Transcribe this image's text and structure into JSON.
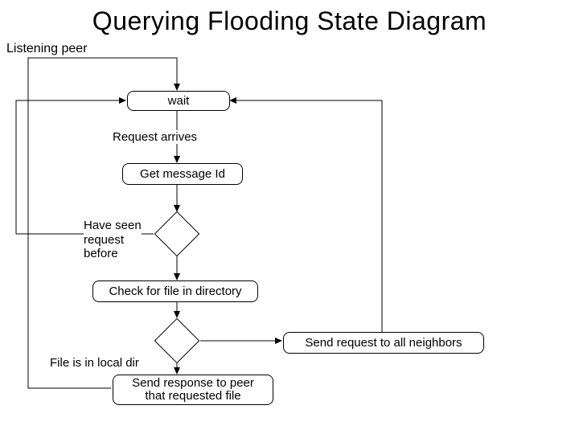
{
  "title": "Querying Flooding State Diagram",
  "subtitle": "Listening peer",
  "boxes": {
    "wait": "wait",
    "get_message": "Get message Id",
    "check_file": "Check for file in directory",
    "send_request": "Send request to all neighbors",
    "send_response": "Send response to peer\nthat requested file"
  },
  "labels": {
    "request_arrives": "Request arrives",
    "have_seen": "Have seen\nrequest\nbefore",
    "file_local": "File is in local dir"
  }
}
